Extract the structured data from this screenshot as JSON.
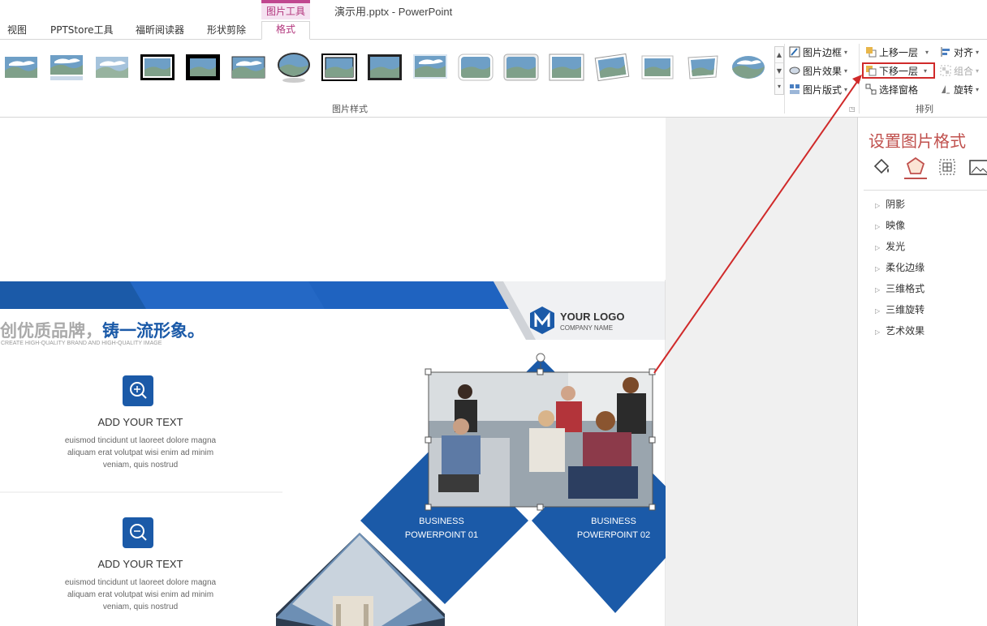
{
  "window": {
    "title": "演示用.pptx - PowerPoint"
  },
  "contextual_tab": "图片工具",
  "tabs": [
    {
      "label": "视图"
    },
    {
      "label": "PPTStore工具"
    },
    {
      "label": "福昕阅读器"
    },
    {
      "label": "形状剪除"
    },
    {
      "label": "格式",
      "active": true
    }
  ],
  "ribbon": {
    "picture_styles_label": "图片样式",
    "picture_border": "图片边框",
    "picture_effects": "图片效果",
    "picture_layout": "图片版式",
    "bring_forward": "上移一层",
    "send_backward": "下移一层",
    "selection_pane": "选择窗格",
    "align": "对齐",
    "group": "组合",
    "rotate": "旋转",
    "arrange_label": "排列"
  },
  "format_pane": {
    "title": "设置图片格式",
    "tab_icons": [
      "fill-line-icon",
      "effects-icon",
      "size-properties-icon",
      "picture-icon"
    ],
    "sections": [
      "阴影",
      "映像",
      "发光",
      "柔化边缘",
      "三维格式",
      "三维旋转",
      "艺术效果"
    ]
  },
  "slide": {
    "headline_gray": "创优质品牌，",
    "headline_blue": "铸一流形象。",
    "subline": "CREATE HIGH-QUALITY BRAND AND HIGH-QUALITY IMAGE",
    "logo_title": "YOUR LOGO",
    "logo_sub": "COMPANY NAME",
    "items": [
      {
        "heading": "ADD YOUR TEXT",
        "body": [
          "euismod tincidunt ut laoreet dolore magna",
          "aliquam erat volutpat wisi enim ad minim",
          "veniam, quis nostrud"
        ],
        "icon": "zoom-in-icon"
      },
      {
        "heading": "ADD YOUR TEXT",
        "body": [
          "euismod tincidunt ut laoreet dolore magna",
          "aliquam erat volutpat wisi enim ad minim",
          "veniam, quis nostrud"
        ],
        "icon": "zoom-out-icon"
      }
    ],
    "diamond1": [
      "BUSINESS",
      "POWERPOINT 01"
    ],
    "diamond2": [
      "BUSINESS",
      "POWERPOINT 02"
    ]
  },
  "colors": {
    "accent_blue": "#1b5aa8",
    "highlight_red": "#d02a2a",
    "pane_title": "#c0504d",
    "tab_accent": "#b2357c"
  }
}
